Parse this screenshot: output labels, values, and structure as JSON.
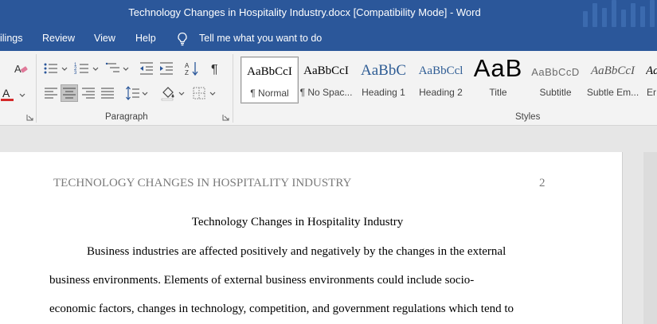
{
  "window": {
    "title": "Technology Changes in Hospitality Industry.docx [Compatibility Mode]  -  Word"
  },
  "tabs": {
    "mailings": "ilings",
    "review": "Review",
    "view": "View",
    "help": "Help"
  },
  "tell_me": "Tell me what you want to do",
  "ribbon": {
    "paragraph_label": "Paragraph",
    "styles_label": "Styles",
    "styles": [
      {
        "sample": "AaBbCcI",
        "name": "¶ Normal",
        "selected": true
      },
      {
        "sample": "AaBbCcI",
        "name": "¶ No Spac..."
      },
      {
        "sample": "AaBbC",
        "name": "Heading 1"
      },
      {
        "sample": "AaBbCcl",
        "name": "Heading 2"
      },
      {
        "sample": "AaB",
        "name": "Title"
      },
      {
        "sample": "AaBbCcD",
        "name": "Subtitle"
      },
      {
        "sample": "AaBbCcI",
        "name": "Subtle Em..."
      },
      {
        "sample": "Aa",
        "name": "Er"
      }
    ],
    "colors": {
      "font_color_underline": "#d42a2a",
      "accent": "#2b579a"
    }
  },
  "document": {
    "running_head": "TECHNOLOGY CHANGES IN HOSPITALITY INDUSTRY",
    "page_number": "2",
    "heading": "Technology Changes in Hospitality Industry",
    "lines": [
      "Business industries are affected positively and negatively by the changes in the external",
      "business environments. Elements of external business environments could include socio-",
      "economic factors, changes in technology, competition, and government regulations which tend to"
    ]
  }
}
